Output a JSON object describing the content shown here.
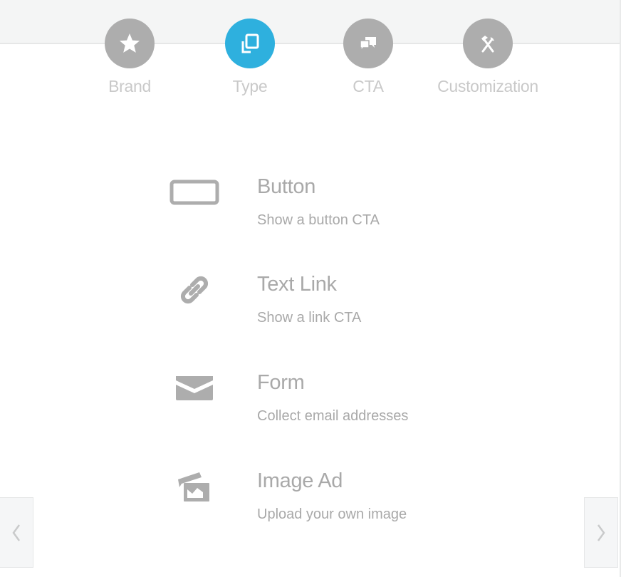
{
  "steps": [
    {
      "label": "Brand",
      "icon": "star-icon",
      "active": false
    },
    {
      "label": "Type",
      "icon": "copy-icon",
      "active": true
    },
    {
      "label": "CTA",
      "icon": "chat-bubbles-icon",
      "active": false
    },
    {
      "label": "Customization",
      "icon": "tools-icon",
      "active": false
    }
  ],
  "options": [
    {
      "title": "Button",
      "description": "Show a button CTA",
      "icon": "button-icon"
    },
    {
      "title": "Text Link",
      "description": "Show a link CTA",
      "icon": "link-icon"
    },
    {
      "title": "Form",
      "description": "Collect email addresses",
      "icon": "envelope-icon"
    },
    {
      "title": "Image Ad",
      "description": "Upload your own image",
      "icon": "image-icon"
    }
  ],
  "colors": {
    "active": "#2eb0de",
    "inactive": "#adadad",
    "text": "#a9a9a9"
  },
  "nav": {
    "prev_icon": "chevron-left-icon",
    "next_icon": "chevron-right-icon"
  }
}
